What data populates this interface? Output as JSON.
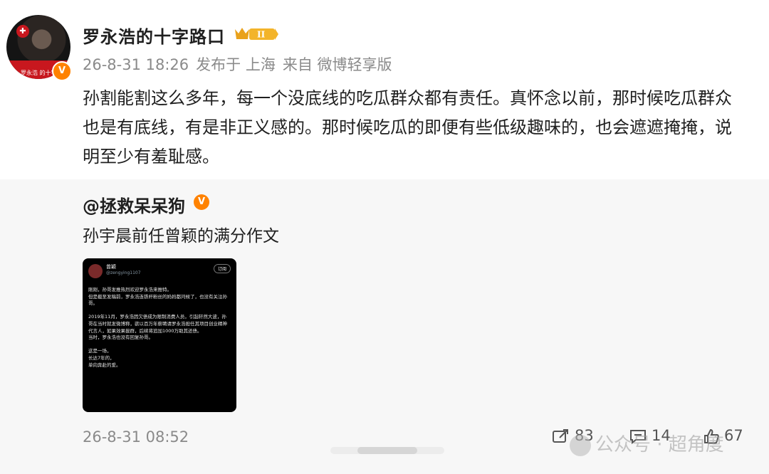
{
  "post": {
    "author": "罗永浩的十字路口",
    "avatar_caption": "罗永浩 的十字路口",
    "rank_badge": "II",
    "time": "26-8-31 18:26",
    "location": "发布于 上海",
    "source": "来自 微博轻享版",
    "body": "孙割能割这么多年，每一个没底线的吃瓜群众都有责任。真怀念以前，那时候吃瓜群众也是有底线，有是非正义感的￼。那时候吃瓜的即便有些低级趣味的，也会遮遮掩掩，说明至少有羞耻感。"
  },
  "repost": {
    "author": "@拯救呆呆狗",
    "text": "孙宇晨前任曾颖的满分作文",
    "thumbnail": {
      "name": "曾颖",
      "handle": "@zengying1107",
      "button": "订阅",
      "body": "刚刚，孙哥发推热烈欢迎罗永浩来推特。\n但是截至发稿前，罗永浩连铁杆粉丝的妈妈都问候了，也没有关注孙哥。\n\n2019年11月，罗永浩因欠债成为限制消费人员，引起轩然大波，孙哥在当时就发微博称，欲以百万年薪聘请罗永浩担任其项目创业精神代言人，如果效果拔群，后续将追加1000万助其还债。\n当时，罗永浩也没有回复孙哥。\n\n这是一场，\n长达7年的，\n单向奔赴的爱。"
    },
    "time": "26-8-31 08:52",
    "repost_count": "83",
    "comment_count": "14",
    "like_count": "67"
  },
  "watermark": "公众号 · 超角度",
  "colors": {
    "verified": "#ff8200",
    "repost_bg": "#f7f7f7",
    "meta": "#8a8a8a"
  }
}
